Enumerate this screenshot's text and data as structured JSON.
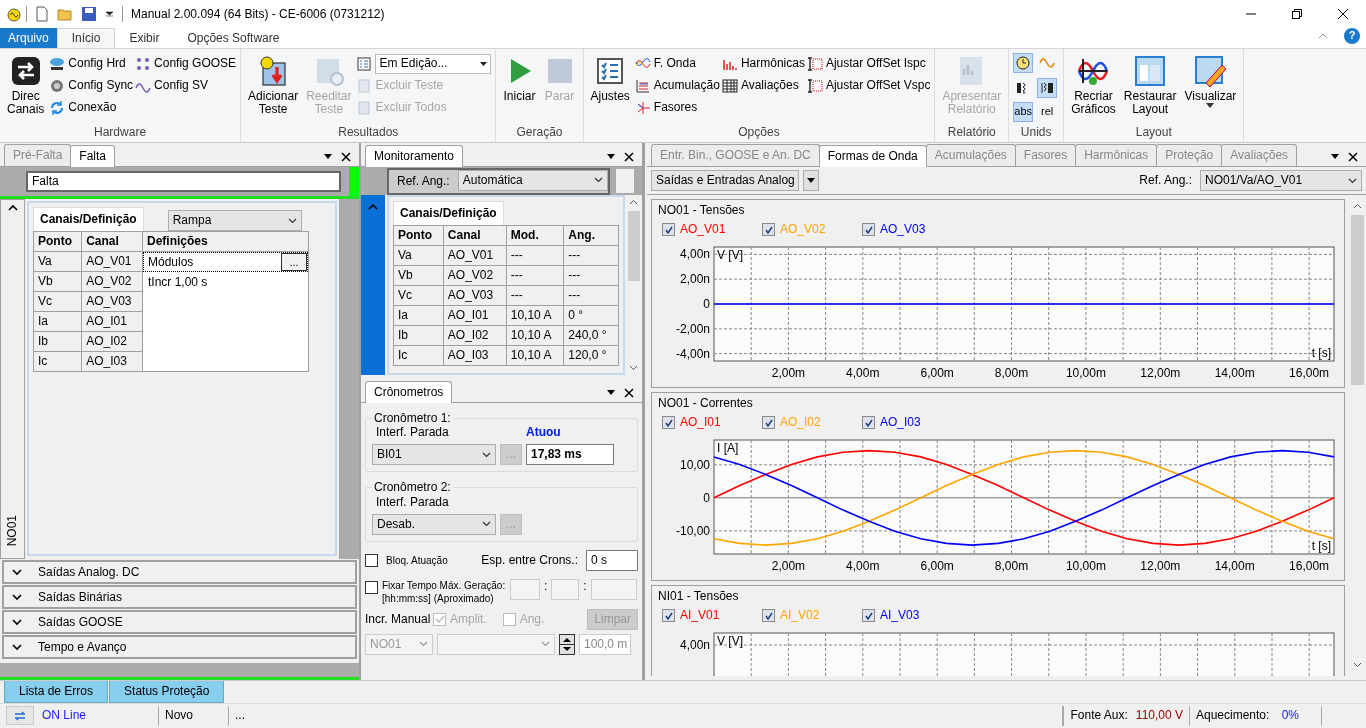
{
  "window": {
    "title": "Manual 2.00.094 (64 Bits) - CE-6006 (0731212)"
  },
  "ribbon": {
    "file_tab": "Arquivo",
    "help": "?",
    "tabs": [
      {
        "label": "Início",
        "selected": true
      },
      {
        "label": "Exibir",
        "selected": false
      },
      {
        "label": "Opções Software",
        "selected": false
      }
    ],
    "groups": [
      {
        "label": "Hardware",
        "items": [
          {
            "kind": "large",
            "lines": [
              "Direc",
              "Canais"
            ],
            "disabled": false
          },
          {
            "kind": "stack",
            "items": [
              {
                "kind": "small",
                "label": "Config Hrd",
                "disabled": false
              },
              {
                "kind": "small",
                "label": "Config Sync",
                "disabled": false
              },
              {
                "kind": "small",
                "label": "Conexão",
                "disabled": false
              }
            ]
          },
          {
            "kind": "stack",
            "items": [
              {
                "kind": "small",
                "label": "Config GOOSE",
                "disabled": false
              },
              {
                "kind": "small",
                "label": "Config SV",
                "disabled": false
              }
            ]
          }
        ]
      },
      {
        "label": "Resultados",
        "items": [
          {
            "kind": "large",
            "lines": [
              "Adicionar",
              "Teste"
            ],
            "disabled": false
          },
          {
            "kind": "large",
            "lines": [
              "Reeditar",
              "Teste"
            ],
            "disabled": true
          },
          {
            "kind": "stack",
            "items": [
              {
                "kind": "combo",
                "value": "Em Edição...",
                "disabled": false
              },
              {
                "kind": "small",
                "label": "Excluir Teste",
                "disabled": true
              },
              {
                "kind": "small",
                "label": "Excluir Todos",
                "disabled": true
              }
            ]
          }
        ]
      },
      {
        "label": "Geração",
        "items": [
          {
            "kind": "large",
            "lines": [
              "Iniciar"
            ],
            "disabled": false
          },
          {
            "kind": "large",
            "lines": [
              "Parar"
            ],
            "disabled": true
          }
        ]
      },
      {
        "label": "Opções",
        "items": [
          {
            "kind": "large",
            "lines": [
              "Ajustes"
            ],
            "disabled": false
          },
          {
            "kind": "stack",
            "items": [
              {
                "kind": "small",
                "label": "F. Onda",
                "disabled": false
              },
              {
                "kind": "small",
                "label": "Acumulação",
                "disabled": false
              },
              {
                "kind": "small",
                "label": "Fasores",
                "disabled": false
              }
            ]
          },
          {
            "kind": "stack",
            "items": [
              {
                "kind": "small",
                "label": "Harmônicas",
                "disabled": false
              },
              {
                "kind": "small",
                "label": "Avaliações",
                "disabled": false
              }
            ]
          },
          {
            "kind": "stack",
            "items": [
              {
                "kind": "small",
                "label": "Ajustar OffSet Ispc",
                "disabled": false
              },
              {
                "kind": "small",
                "label": "Ajustar OffSet Vspc",
                "disabled": false
              }
            ]
          }
        ]
      },
      {
        "label": "Relatório",
        "items": [
          {
            "kind": "large",
            "lines": [
              "Apresentar",
              "Relatório"
            ],
            "disabled": true
          }
        ]
      },
      {
        "label": "Unids",
        "items": [
          {
            "kind": "toggles",
            "items": [
              {
                "kind": "icon",
                "selected": true
              },
              {
                "kind": "icon",
                "selected": false
              },
              {
                "kind": "icon",
                "selected": false
              },
              {
                "kind": "icon",
                "selected": true
              },
              {
                "kind": "text",
                "label": "abs",
                "selected": true
              },
              {
                "kind": "text",
                "label": "rel",
                "selected": false
              }
            ]
          }
        ]
      },
      {
        "label": "Layout",
        "items": [
          {
            "kind": "large",
            "lines": [
              "Recriar",
              "Gráficos"
            ],
            "disabled": false
          },
          {
            "kind": "large",
            "lines": [
              "Restaurar",
              "Layout"
            ],
            "disabled": false
          },
          {
            "kind": "large",
            "lines": [
              "Visualizar"
            ],
            "disabled": false,
            "dropdown": true
          }
        ]
      }
    ]
  },
  "fault_panel": {
    "tabs": [
      {
        "label": "Pré-Falta",
        "selected": false
      },
      {
        "label": "Falta",
        "selected": true
      }
    ],
    "name_field": "Falta",
    "active": true,
    "section": {
      "label": "NO01",
      "expanded": true,
      "tab": "Canais/Definição",
      "mode": "Rampa",
      "columns": [
        "Ponto",
        "Canal",
        "Definições"
      ],
      "rows": [
        {
          "point": "Va",
          "channel": "AO_V01"
        },
        {
          "point": "Vb",
          "channel": "AO_V02"
        },
        {
          "point": "Vc",
          "channel": "AO_V03"
        },
        {
          "point": "Ia",
          "channel": "AO_I01"
        },
        {
          "point": "Ib",
          "channel": "AO_I02"
        },
        {
          "point": "Ic",
          "channel": "AO_I03"
        }
      ],
      "definitions": [
        {
          "text": "Módulos",
          "button": "...",
          "selected": true
        },
        {
          "text": "tIncr 1,00 s",
          "selected": false
        }
      ]
    },
    "collapsed_sections": [
      {
        "label": "Saídas Analog. DC",
        "expanded": false
      },
      {
        "label": "Saídas Binárias",
        "expanded": false
      },
      {
        "label": "Saídas GOOSE",
        "expanded": false
      },
      {
        "label": "Tempo e Avanço",
        "expanded": false
      }
    ]
  },
  "monitor_panel": {
    "tabs": [
      {
        "label": "Monitoramento",
        "selected": true
      }
    ],
    "ref_label": "Ref. Ang.:",
    "ref_value": "Automática",
    "expanded": true,
    "tab": "Canais/Definição",
    "columns": [
      "Ponto",
      "Canal",
      "Mod.",
      "Ang."
    ],
    "rows": [
      [
        "Va",
        "AO_V01",
        "---",
        "---"
      ],
      [
        "Vb",
        "AO_V02",
        "---",
        "---"
      ],
      [
        "Vc",
        "AO_V03",
        "---",
        "---"
      ],
      [
        "Ia",
        "AO_I01",
        "10,10 A",
        "0 °"
      ],
      [
        "Ib",
        "AO_I02",
        "10,10 A",
        "240,0 °"
      ],
      [
        "Ic",
        "AO_I03",
        "10,10 A",
        "120,0 °"
      ]
    ]
  },
  "chrono_panel": {
    "tabs": [
      {
        "label": "Crônometros",
        "selected": true
      }
    ],
    "timers": [
      {
        "title": "Cronômetro 1:",
        "stop_label": "Interf. Parada",
        "stop_value": "BI01",
        "button": "...",
        "result_label": "Atuou",
        "result_value": "17,83 ms"
      },
      {
        "title": "Cronômetro 2:",
        "stop_label": "Interf. Parada",
        "stop_value": "Desab.",
        "button": "..."
      }
    ],
    "block": {
      "label": "Bloq. Atuação",
      "checked": false
    },
    "spacing_label": "Esp. entre Crons.:",
    "spacing_value": "0 s",
    "fix_time": {
      "label": "Fixar Tempo Máx. Geração:",
      "hint": "[hh:mm:ss] (Aproximado)",
      "checked": false,
      "separators": [
        ":",
        ":"
      ]
    },
    "manual": {
      "label": "Incr. Manual",
      "options": [
        {
          "label": "Amplit.",
          "checked": true,
          "disabled": true
        },
        {
          "label": "Ang.",
          "checked": false,
          "disabled": true
        }
      ],
      "clear_button": "Limpar",
      "clear_disabled": true,
      "node": "NO01",
      "step": "100,0 m"
    }
  },
  "waveform_panel": {
    "tabs": [
      {
        "label": "Entr. Bin., GOOSE e An. DC",
        "selected": false
      },
      {
        "label": "Formas de Onda",
        "selected": true
      },
      {
        "label": "Acumulações",
        "selected": false
      },
      {
        "label": "Fasores",
        "selected": false
      },
      {
        "label": "Harmônicas",
        "selected": false
      },
      {
        "label": "Proteção",
        "selected": false
      },
      {
        "label": "Avaliações",
        "selected": false
      }
    ],
    "view_select": "Saídas e Entradas Analog",
    "ref_label": "Ref. Ang.:",
    "ref_value": "NO01/Va/AO_V01",
    "charts": [
      {
        "title": "NO01 - Tensões",
        "legend": [
          {
            "checked": true
          },
          {
            "checked": true
          },
          {
            "checked": true
          }
        ],
        "chart_data": {
          "type": "line",
          "xlabel": "t [s]",
          "ylabel": "V [V]",
          "x": [
            0,
            0.69,
            1.39,
            2.08,
            2.78,
            3.47,
            4.17,
            4.86,
            5.56,
            6.25,
            6.94,
            7.64,
            8.33,
            9.03,
            9.72,
            10.42,
            11.11,
            11.81,
            12.5,
            13.19,
            13.89,
            14.58,
            15.28,
            15.97,
            16.67
          ],
          "series": [
            {
              "name": "AO_V01",
              "color": "#ff0000",
              "values": [
                null,
                null,
                null,
                null,
                null,
                null,
                null,
                null,
                null,
                null,
                null,
                null,
                null,
                null,
                null,
                null,
                null,
                null,
                null,
                null,
                null,
                null,
                null,
                null,
                null
              ]
            },
            {
              "name": "AO_V02",
              "color": "#ffa500",
              "values": [
                null,
                null,
                null,
                null,
                null,
                null,
                null,
                null,
                null,
                null,
                null,
                null,
                null,
                null,
                null,
                null,
                null,
                null,
                null,
                null,
                null,
                null,
                null,
                null,
                null
              ]
            },
            {
              "name": "AO_V03",
              "color": "#0000ff",
              "values": [
                0,
                0,
                0,
                0,
                0,
                0,
                0,
                0,
                0,
                0,
                0,
                0,
                0,
                0,
                0,
                0,
                0,
                0,
                0,
                0,
                0,
                0,
                0,
                0,
                0
              ]
            }
          ],
          "xlim": [
            0,
            16.67
          ],
          "ylim": [
            -4.6,
            4.6
          ],
          "grid": true,
          "xticks": [
            {
              "value": 2,
              "label": "2,00m"
            },
            {
              "value": 4,
              "label": "4,00m"
            },
            {
              "value": 6,
              "label": "6,00m"
            },
            {
              "value": 8,
              "label": "8,00m"
            },
            {
              "value": 10,
              "label": "10,00m"
            },
            {
              "value": 12,
              "label": "12,00m"
            },
            {
              "value": 14,
              "label": "14,00m"
            },
            {
              "value": 16,
              "label": "16,00m"
            }
          ],
          "yticks": [
            {
              "value": 4,
              "label": "4,00n"
            },
            {
              "value": 2,
              "label": "2,00n"
            },
            {
              "value": 0,
              "label": "0"
            },
            {
              "value": -2,
              "label": "-2,00n"
            },
            {
              "value": -4,
              "label": "-4,00n"
            }
          ]
        }
      },
      {
        "title": "NO01 - Correntes",
        "legend": [
          {
            "checked": true
          },
          {
            "checked": true
          },
          {
            "checked": true
          }
        ],
        "chart_data": {
          "type": "line",
          "xlabel": "t [s]",
          "ylabel": "I [A]",
          "x": [
            0,
            0.69,
            1.39,
            2.08,
            2.78,
            3.47,
            4.17,
            4.86,
            5.56,
            6.25,
            6.94,
            7.64,
            8.33,
            9.03,
            9.72,
            10.42,
            11.11,
            11.81,
            12.5,
            13.19,
            13.89,
            14.58,
            15.28,
            15.97,
            16.67
          ],
          "series": [
            {
              "name": "AO_I01",
              "color": "#ff0000",
              "values": [
                0,
                3.7,
                7.1,
                10.1,
                12.4,
                13.8,
                14.3,
                13.8,
                12.4,
                10.1,
                7.1,
                3.7,
                0,
                -3.7,
                -7.1,
                -10.1,
                -12.4,
                -13.8,
                -14.3,
                -13.8,
                -12.4,
                -10.1,
                -7.1,
                -3.7,
                0
              ]
            },
            {
              "name": "AO_I02",
              "color": "#ffa500",
              "values": [
                -12.4,
                -13.8,
                -14.3,
                -13.8,
                -12.4,
                -10.1,
                -7.1,
                -3.7,
                0,
                3.7,
                7.1,
                10.1,
                12.4,
                13.8,
                14.3,
                13.8,
                12.4,
                10.1,
                7.1,
                3.7,
                0,
                -3.7,
                -7.1,
                -10.1,
                -12.4
              ]
            },
            {
              "name": "AO_I03",
              "color": "#0000ff",
              "values": [
                12.4,
                10.1,
                7.1,
                3.7,
                0,
                -3.7,
                -7.1,
                -10.1,
                -12.4,
                -13.8,
                -14.3,
                -13.8,
                -12.4,
                -10.1,
                -7.1,
                -3.7,
                0,
                3.7,
                7.1,
                10.1,
                12.4,
                13.8,
                14.3,
                13.8,
                12.4
              ]
            }
          ],
          "xlim": [
            0,
            16.67
          ],
          "ylim": [
            -17,
            17.5
          ],
          "grid": true,
          "xticks": [
            {
              "value": 2,
              "label": "2,00m"
            },
            {
              "value": 4,
              "label": "4,00m"
            },
            {
              "value": 6,
              "label": "6,00m"
            },
            {
              "value": 8,
              "label": "8,00m"
            },
            {
              "value": 10,
              "label": "10,00m"
            },
            {
              "value": 12,
              "label": "12,00m"
            },
            {
              "value": 14,
              "label": "14,00m"
            },
            {
              "value": 16,
              "label": "16,00m"
            }
          ],
          "yticks": [
            {
              "value": 10,
              "label": "10,00"
            },
            {
              "value": 0,
              "label": "0"
            },
            {
              "value": -10,
              "label": "-10,00"
            }
          ]
        }
      },
      {
        "title": "NI01 - Tensões",
        "legend": [
          {
            "label": "AI_V01",
            "color": "#ff0000",
            "checked": true
          },
          {
            "label": "AI_V02",
            "color": "#ffa500",
            "checked": true
          },
          {
            "label": "AI_V03",
            "color": "#0000ff",
            "checked": true
          }
        ],
        "ylabel": "V [V]",
        "ytick_labels": [
          "4,00n"
        ]
      }
    ]
  },
  "bottom_tabs": [
    "Lista de Erros",
    "Status Proteção"
  ],
  "status_bar": {
    "connection": "ON Line",
    "state": "Novo",
    "message": "...",
    "aux_label": "Fonte Aux:",
    "aux_value": "110,00 V",
    "heat_label": "Aquecimento:",
    "heat_value": "0%"
  }
}
